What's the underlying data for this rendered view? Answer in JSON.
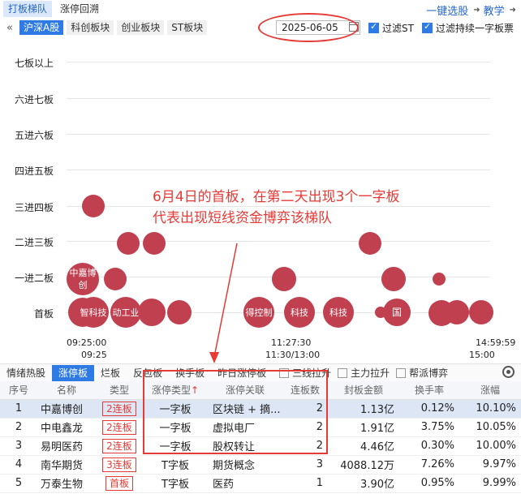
{
  "top_tabs": [
    {
      "label": "打板梯队",
      "active": true
    },
    {
      "label": "涨停回溯",
      "active": false
    }
  ],
  "top_right": {
    "screener": "一键选股",
    "tutorial": "教学"
  },
  "market_tabs": [
    {
      "label": "沪深A股",
      "active": true
    },
    {
      "label": "科创板块",
      "active": false
    },
    {
      "label": "创业板块",
      "active": false
    },
    {
      "label": "ST板块",
      "active": false
    }
  ],
  "date": "2025-06-05",
  "filters": {
    "filter_st": "过滤ST",
    "filter_one_word": "过滤持续一字板票"
  },
  "tiers": [
    "七板以上",
    "六进七板",
    "五进六板",
    "四进五板",
    "三进四板",
    "二进三板",
    "一进二板",
    "首板"
  ],
  "bubbles": {
    "tier_3to4": [
      {
        "label": ""
      }
    ],
    "tier_2to3": [
      {
        "label": ""
      },
      {
        "label": ""
      },
      {
        "label": ""
      }
    ],
    "tier_1to2": [
      {
        "label": "中嘉博创"
      },
      {
        "label": ""
      },
      {
        "label": ""
      },
      {
        "label": ""
      },
      {
        "label": ""
      }
    ],
    "tier_first": [
      {
        "label": ""
      },
      {
        "label": "智科技"
      },
      {
        "label": "动工业"
      },
      {
        "label": ""
      },
      {
        "label": ""
      },
      {
        "label": "得控制"
      },
      {
        "label": "科技"
      },
      {
        "label": "科技"
      },
      {
        "label": ""
      },
      {
        "label": "国"
      },
      {
        "label": ""
      },
      {
        "label": ""
      },
      {
        "label": ""
      }
    ]
  },
  "time_axis": {
    "start": "09:25:00",
    "start2": "09:25",
    "mid": "11:27:30",
    "mid2": "11:30/13:00",
    "end": "14:59:59",
    "end2": "15:00"
  },
  "annotation": {
    "line1": "6月4日的首板，在第二天出现3个一字板",
    "line2": "代表出现短线资金博弈该梯队"
  },
  "bottom_tabs": [
    {
      "label": "情绪热股",
      "active": false
    },
    {
      "label": "涨停板",
      "active": true
    },
    {
      "label": "烂板",
      "active": false
    },
    {
      "label": "反包板",
      "active": false
    },
    {
      "label": "换手板",
      "active": false
    },
    {
      "label": "昨日涨停板",
      "active": false
    }
  ],
  "bottom_checks": [
    "三线拉升",
    "主力拉升",
    "帮派博弈"
  ],
  "table": {
    "headers": [
      "序号",
      "名称",
      "类型",
      "涨停类型",
      "涨停关联",
      "连板数",
      "封板金额",
      "换手率",
      "涨幅"
    ],
    "sort_mark": "↑",
    "rows": [
      {
        "no": "1",
        "name": "中嘉博创",
        "name_color": "pink",
        "type": "2连板",
        "zt_type": "一字板",
        "relation": "区块链 + 摘...",
        "count": "2",
        "seal": "1.13亿",
        "turnover": "0.12%",
        "change": "10.10%",
        "selected": true
      },
      {
        "no": "2",
        "name": "中电鑫龙",
        "name_color": "blue",
        "type": "2连板",
        "zt_type": "一字板",
        "relation": "虚拟电厂",
        "count": "2",
        "seal": "1.91亿",
        "turnover": "3.75%",
        "change": "10.05%",
        "selected": false
      },
      {
        "no": "3",
        "name": "易明医药",
        "name_color": "default",
        "type": "2连板",
        "zt_type": "一字板",
        "relation": "股权转让",
        "count": "2",
        "seal": "4.46亿",
        "turnover": "0.30%",
        "change": "10.00%",
        "selected": false
      },
      {
        "no": "4",
        "name": "南华期货",
        "name_color": "default",
        "type": "3连板",
        "zt_type": "T字板",
        "relation": "期货概念",
        "count": "3",
        "seal": "4088.12万",
        "turnover": "7.26%",
        "change": "9.97%",
        "selected": false
      },
      {
        "no": "5",
        "name": "万泰生物",
        "name_color": "default",
        "type": "首板",
        "zt_type": "T字板",
        "relation": "医药",
        "count": "1",
        "seal": "3.90亿",
        "turnover": "0.95%",
        "change": "9.99%",
        "selected": false
      }
    ]
  },
  "colors": {
    "accent": "#2f7be6",
    "bubble": "#c04050",
    "highlight_red": "#e53a36"
  }
}
